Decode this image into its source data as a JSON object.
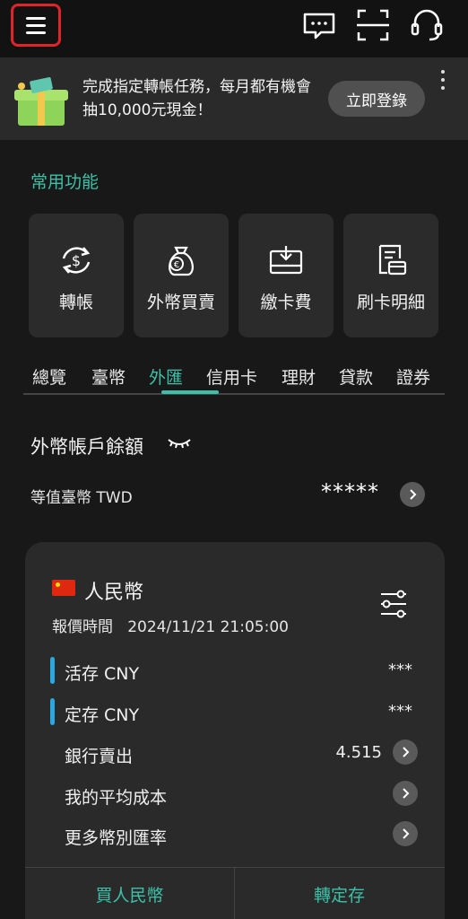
{
  "banner": {
    "text": "完成指定轉帳任務，每月都有機會抽10,000元現金！",
    "login_label": "立即登錄"
  },
  "quick": {
    "title": "常用功能",
    "items": [
      {
        "label": "轉帳",
        "icon": "transfer-icon"
      },
      {
        "label": "外幣買賣",
        "icon": "fx-exchange-icon"
      },
      {
        "label": "繳卡費",
        "icon": "pay-card-icon"
      },
      {
        "label": "刷卡明細",
        "icon": "card-statement-icon"
      }
    ]
  },
  "tabs": [
    "總覽",
    "臺幣",
    "外匯",
    "信用卡",
    "理財",
    "貸款",
    "證券"
  ],
  "active_tab": "外匯",
  "fx": {
    "title": "外幣帳戶餘額",
    "twd_label": "等值臺幣 TWD",
    "masked_balance": "*****"
  },
  "card": {
    "currency": "人民幣",
    "quote_time": "報價時間   2024/11/21 21:05:00",
    "rows": [
      {
        "label": "活存 CNY",
        "value": "***"
      },
      {
        "label": "定存 CNY",
        "value": "***"
      },
      {
        "label": "銀行賣出",
        "value": "4.515"
      },
      {
        "label": "我的平均成本",
        "value": ""
      },
      {
        "label": "更多幣別匯率",
        "value": ""
      }
    ],
    "buy_label": "買人民幣",
    "fixed_label": "轉定存"
  },
  "colors": {
    "accent": "#3cc0a8",
    "bar": "#2aa7e0",
    "highlight": "#e0242a"
  }
}
